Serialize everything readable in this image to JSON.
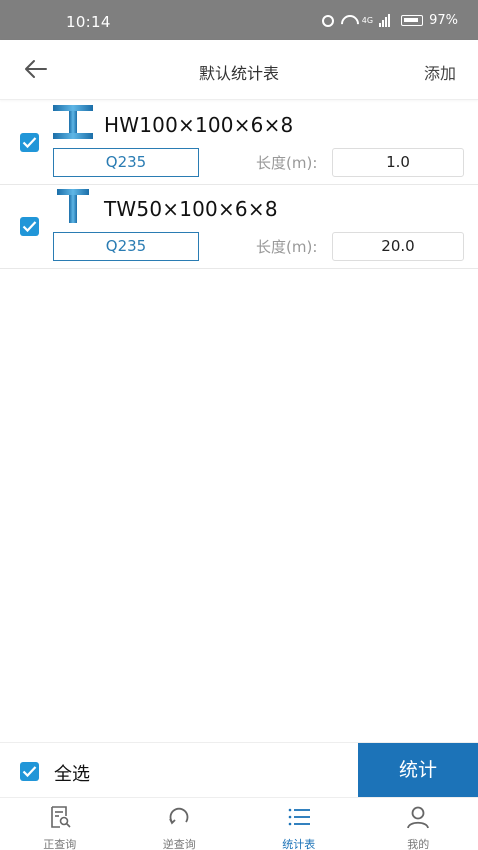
{
  "status": {
    "time": "10:14",
    "signal_label": "4G",
    "battery": "97%"
  },
  "nav": {
    "title": "默认统计表",
    "add_label": "添加"
  },
  "items": [
    {
      "name": "HW100×100×6×8",
      "material": "Q235",
      "length_label": "长度(m):",
      "length_value": "1.0",
      "checked": true,
      "shape": "H-beam"
    },
    {
      "name": "TW50×100×6×8",
      "material": "Q235",
      "length_label": "长度(m):",
      "length_value": "20.0",
      "checked": true,
      "shape": "T-beam"
    }
  ],
  "bottom": {
    "select_all_label": "全选",
    "stat_button": "统计"
  },
  "tabs": [
    {
      "label": "正查询",
      "icon": "search-doc-icon",
      "active": false
    },
    {
      "label": "逆查询",
      "icon": "refresh-icon",
      "active": false
    },
    {
      "label": "统计表",
      "icon": "list-icon",
      "active": true
    },
    {
      "label": "我的",
      "icon": "user-icon",
      "active": false
    }
  ],
  "colors": {
    "accent": "#1c73b8",
    "checkbox": "#2196d8",
    "statusbar": "#7f7f7f"
  }
}
